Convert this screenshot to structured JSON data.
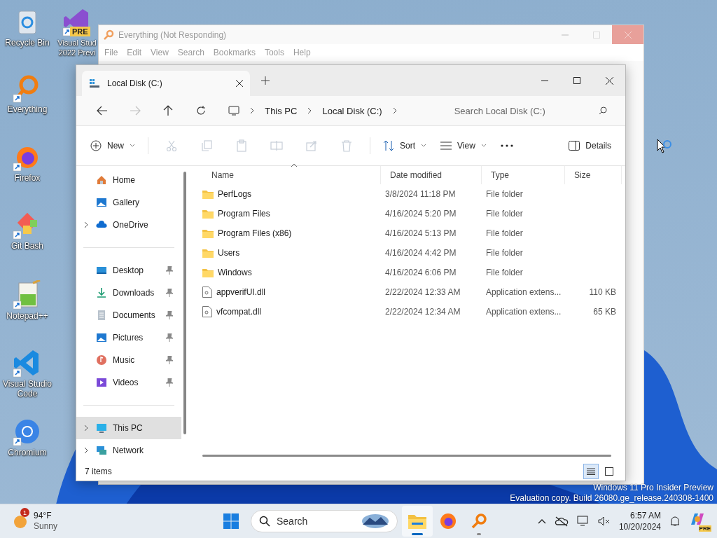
{
  "desktop_icons": [
    {
      "label": "Recycle Bin",
      "shortcut": false
    },
    {
      "label": "Everything",
      "shortcut": true
    },
    {
      "label": "Firefox",
      "shortcut": true
    },
    {
      "label": "Git Bash",
      "shortcut": true
    },
    {
      "label": "Notepad++",
      "shortcut": true
    },
    {
      "label": "Visual Studio Code",
      "shortcut": true
    },
    {
      "label": "Chromium",
      "shortcut": true
    }
  ],
  "desktop_icon_partial": {
    "label": "Visual Stud\n2022 Previ",
    "badge": "PRE",
    "shortcut": true
  },
  "everything_window": {
    "title": "Everything (Not Responding)",
    "menu": [
      "File",
      "Edit",
      "View",
      "Search",
      "Bookmarks",
      "Tools",
      "Help"
    ]
  },
  "explorer": {
    "tab": {
      "title": "Local Disk (C:)"
    },
    "nav": [
      {
        "disabled": false
      },
      {
        "disabled": true
      },
      {
        "disabled": false
      },
      {
        "disabled": false
      }
    ],
    "breadcrumb": [
      "This PC",
      "Local Disk (C:)"
    ],
    "search": {
      "placeholder": "Search Local Disk (C:)"
    },
    "toolbar": {
      "new": "New",
      "actions": [
        {
          "disabled": true
        },
        {
          "disabled": true
        },
        {
          "disabled": true
        },
        {
          "disabled": true
        },
        {
          "disabled": true
        },
        {
          "disabled": true
        }
      ],
      "sort": "Sort",
      "view": "View",
      "details": "Details"
    },
    "sidebar": {
      "sections": [
        [
          {
            "label": "Home",
            "expandable": false,
            "pinned": false,
            "selected": false
          },
          {
            "label": "Gallery",
            "expandable": false,
            "pinned": false,
            "selected": false
          },
          {
            "label": "OneDrive",
            "expandable": true,
            "pinned": false,
            "selected": false
          }
        ],
        [
          {
            "label": "Desktop",
            "expandable": false,
            "pinned": true,
            "selected": false
          },
          {
            "label": "Downloads",
            "expandable": false,
            "pinned": true,
            "selected": false
          },
          {
            "label": "Documents",
            "expandable": false,
            "pinned": true,
            "selected": false
          },
          {
            "label": "Pictures",
            "expandable": false,
            "pinned": true,
            "selected": false
          },
          {
            "label": "Music",
            "expandable": false,
            "pinned": true,
            "selected": false
          },
          {
            "label": "Videos",
            "expandable": false,
            "pinned": true,
            "selected": false
          }
        ],
        [
          {
            "label": "This PC",
            "expandable": true,
            "pinned": false,
            "selected": true
          },
          {
            "label": "Network",
            "expandable": true,
            "pinned": false,
            "selected": false
          }
        ]
      ]
    },
    "table": {
      "columns": [
        {
          "label": "Name",
          "sorted": true
        },
        {
          "label": "Date modified",
          "sorted": false
        },
        {
          "label": "Type",
          "sorted": false
        },
        {
          "label": "Size",
          "sorted": false
        }
      ],
      "rows": [
        {
          "kind": "folder",
          "name": "PerfLogs",
          "date": "3/8/2024 11:18 PM",
          "type": "File folder"
        },
        {
          "kind": "folder",
          "name": "Program Files",
          "date": "4/16/2024 5:20 PM",
          "type": "File folder"
        },
        {
          "kind": "folder",
          "name": "Program Files (x86)",
          "date": "4/16/2024 5:13 PM",
          "type": "File folder"
        },
        {
          "kind": "folder",
          "name": "Users",
          "date": "4/16/2024 4:42 PM",
          "type": "File folder"
        },
        {
          "kind": "folder",
          "name": "Windows",
          "date": "4/16/2024 6:06 PM",
          "type": "File folder"
        },
        {
          "kind": "file",
          "name": "appverifUI.dll",
          "date": "2/22/2024 12:33 AM",
          "type": "Application extens...",
          "size": "110 KB"
        },
        {
          "kind": "file",
          "name": "vfcompat.dll",
          "date": "2/22/2024 12:34 AM",
          "type": "Application extens...",
          "size": "65 KB"
        }
      ]
    },
    "status_bar": {
      "count": "7 items",
      "views": [
        {
          "selected": true
        },
        {
          "selected": false
        }
      ]
    }
  },
  "system_watermark": [
    "Windows 11 Pro Insider Preview",
    "Evaluation copy. Build 26080.ge_release.240308-1400"
  ],
  "taskbar": {
    "weather": {
      "badge": "1",
      "temperature": "94°F",
      "condition": "Sunny"
    },
    "search": {
      "placeholder": "Search"
    },
    "apps": [
      {
        "open": true,
        "active": true
      },
      {
        "open": false,
        "active": false
      },
      {
        "open": true,
        "active": false
      }
    ],
    "clock": {
      "time": "6:57 AM",
      "date": "10/20/2024"
    },
    "copilot_badge": "PRE"
  }
}
